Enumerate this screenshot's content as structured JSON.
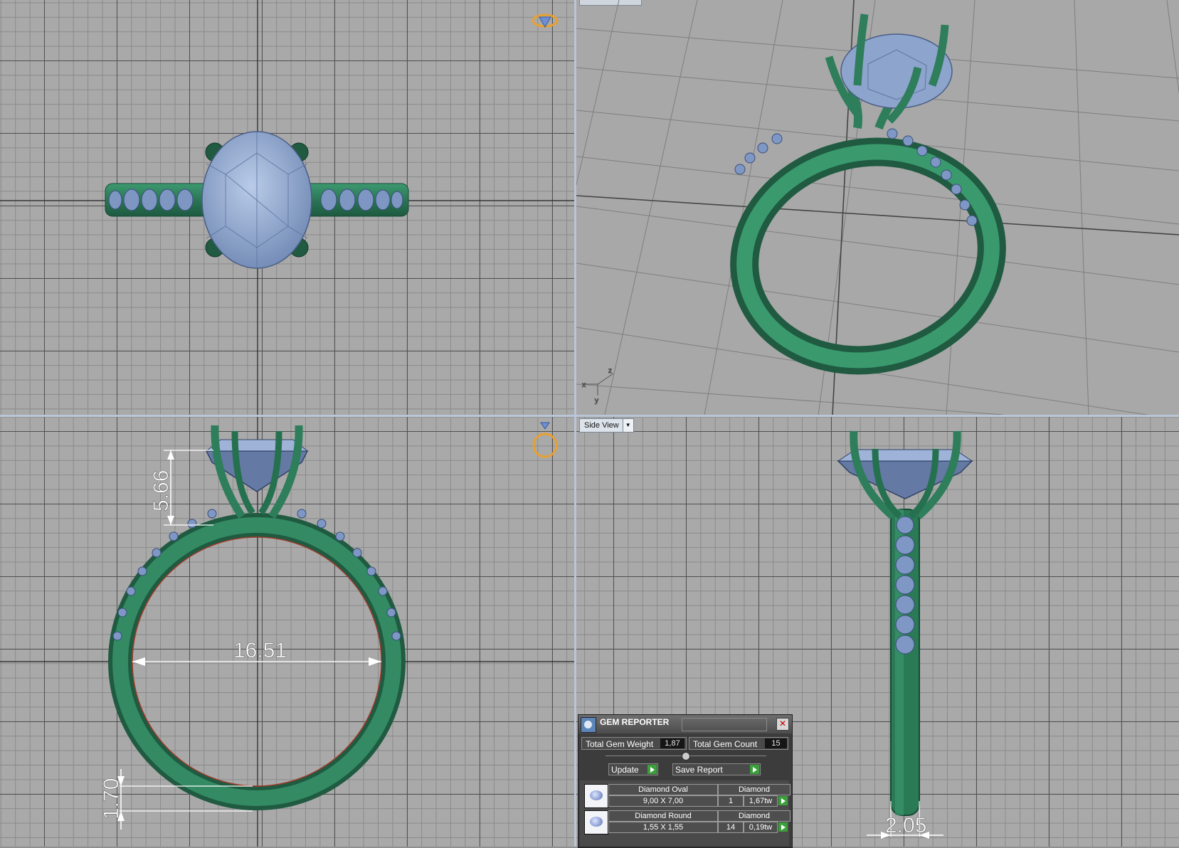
{
  "viewports": {
    "side_label": "Side View",
    "side_dropdown_icon": "chevron-down-icon"
  },
  "dimensions": {
    "prong_height": "5.66",
    "inner_diameter": "16.51",
    "shank_thickness": "1.70",
    "shank_width": "2.05"
  },
  "axes": {
    "x": "x",
    "y": "y",
    "z": "z"
  },
  "gem_reporter": {
    "title": "GEM REPORTER",
    "total_weight_label": "Total Gem Weight",
    "total_weight_value": "1,87",
    "total_count_label": "Total Gem Count",
    "total_count_value": "15",
    "update_label": "Update",
    "save_report_label": "Save Report",
    "rows": [
      {
        "name": "Diamond Oval",
        "size": "9,00 X 7,00",
        "material": "Diamond",
        "count": "1",
        "weight": "1,67tw"
      },
      {
        "name": "Diamond Round",
        "size": "1,55 X 1,55",
        "material": "Diamond",
        "count": "14",
        "weight": "0,19tw"
      }
    ]
  },
  "colors": {
    "metal": "#2e7d5b",
    "gem": "#8fa6cc",
    "accent": "#e8a030"
  }
}
